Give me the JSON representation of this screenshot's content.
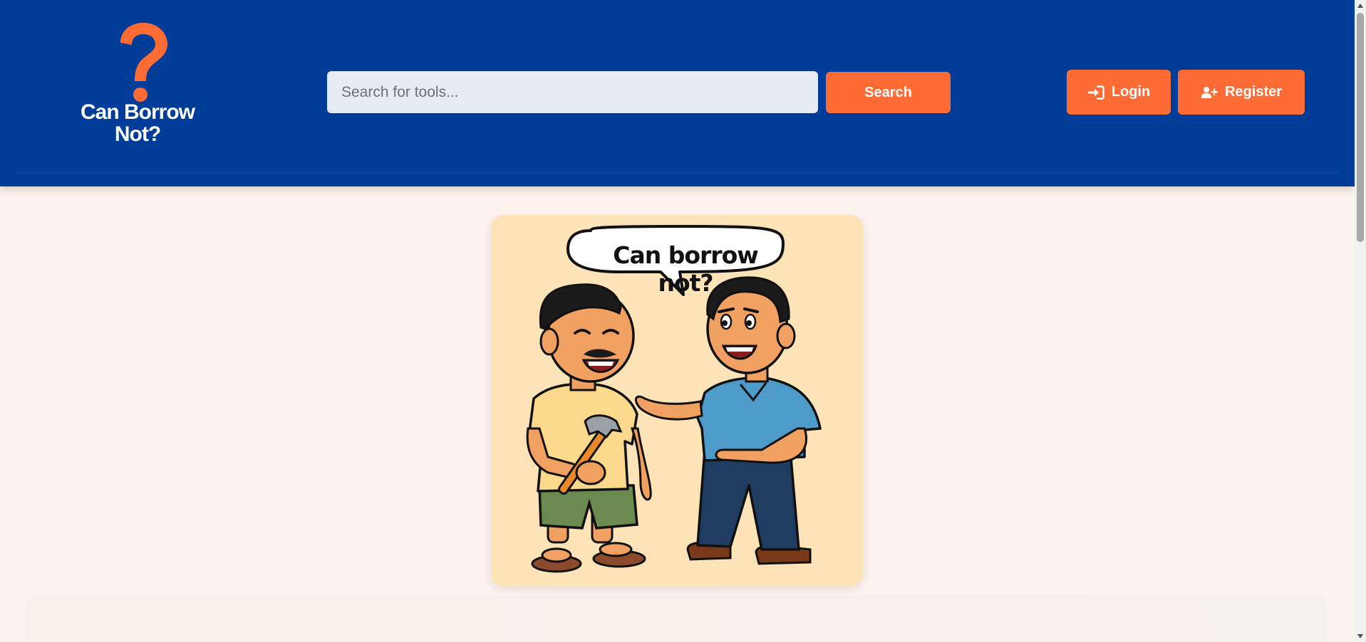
{
  "brand": {
    "name_line1": "Can Borrow",
    "name_line2": "Not?",
    "logo_icon": "question-mark-icon",
    "accent_color": "#ff6b35",
    "header_color": "#003d99"
  },
  "search": {
    "placeholder": "Search for tools...",
    "value": "",
    "button_label": "Search"
  },
  "auth": {
    "login_label": "Login",
    "login_icon": "sign-in-icon",
    "register_label": "Register",
    "register_icon": "user-plus-icon"
  },
  "hero": {
    "speech_bubble": "Can borrow not?"
  }
}
